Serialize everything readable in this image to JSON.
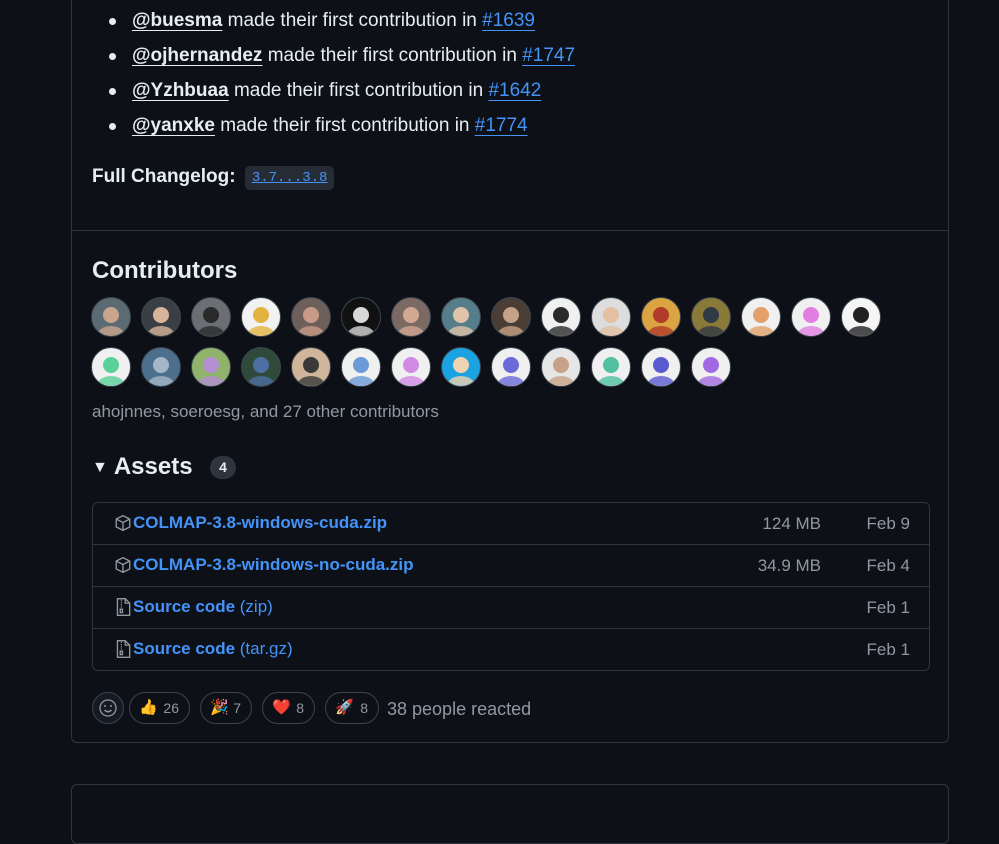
{
  "new_contributors": [
    {
      "user": "@buesma",
      "text": "made their first contribution in",
      "pr": "#1639"
    },
    {
      "user": "@ojhernandez",
      "text": "made their first contribution in",
      "pr": "#1747"
    },
    {
      "user": "@Yzhbuaa",
      "text": "made their first contribution in",
      "pr": "#1642"
    },
    {
      "user": "@yanxke",
      "text": "made their first contribution in",
      "pr": "#1774"
    }
  ],
  "changelog": {
    "label": "Full Changelog:",
    "link": "3.7...3.8"
  },
  "contributors": {
    "heading": "Contributors",
    "note": "ahojnnes, soeroesg, and 27 other contributors"
  },
  "assets": {
    "heading": "Assets",
    "count": "4",
    "items": [
      {
        "icon": "package-icon",
        "name": "COLMAP-3.8-windows-cuda.zip",
        "sub": "",
        "size": "124 MB",
        "date": "Feb 9"
      },
      {
        "icon": "package-icon",
        "name": "COLMAP-3.8-windows-no-cuda.zip",
        "sub": "",
        "size": "34.9 MB",
        "date": "Feb 4"
      },
      {
        "icon": "file-zip-icon",
        "name": "Source code",
        "sub": " (zip)",
        "size": "",
        "date": "Feb 1"
      },
      {
        "icon": "file-zip-icon",
        "name": "Source code",
        "sub": " (tar.gz)",
        "size": "",
        "date": "Feb 1"
      }
    ]
  },
  "reactions": {
    "items": [
      {
        "emoji": "👍",
        "count": "26"
      },
      {
        "emoji": "🎉",
        "count": "7"
      },
      {
        "emoji": "❤️",
        "count": "8"
      },
      {
        "emoji": "🚀",
        "count": "8"
      }
    ],
    "summary": "38 people reacted"
  },
  "colors": {
    "link": "#4493f8",
    "background": "#0d1117",
    "border": "#30363d",
    "muted": "#9198a1"
  }
}
